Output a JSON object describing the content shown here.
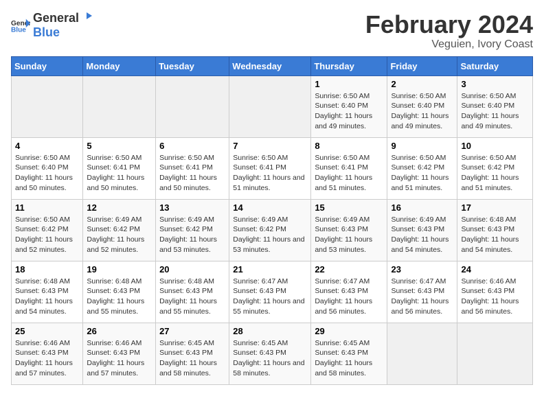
{
  "header": {
    "logo_general": "General",
    "logo_blue": "Blue",
    "title": "February 2024",
    "subtitle": "Veguien, Ivory Coast"
  },
  "weekdays": [
    "Sunday",
    "Monday",
    "Tuesday",
    "Wednesday",
    "Thursday",
    "Friday",
    "Saturday"
  ],
  "weeks": [
    [
      {
        "day": "",
        "empty": true
      },
      {
        "day": "",
        "empty": true
      },
      {
        "day": "",
        "empty": true
      },
      {
        "day": "",
        "empty": true
      },
      {
        "day": "1",
        "sunrise": "6:50 AM",
        "sunset": "6:40 PM",
        "daylight": "11 hours and 49 minutes."
      },
      {
        "day": "2",
        "sunrise": "6:50 AM",
        "sunset": "6:40 PM",
        "daylight": "11 hours and 49 minutes."
      },
      {
        "day": "3",
        "sunrise": "6:50 AM",
        "sunset": "6:40 PM",
        "daylight": "11 hours and 49 minutes."
      }
    ],
    [
      {
        "day": "4",
        "sunrise": "6:50 AM",
        "sunset": "6:40 PM",
        "daylight": "11 hours and 50 minutes."
      },
      {
        "day": "5",
        "sunrise": "6:50 AM",
        "sunset": "6:41 PM",
        "daylight": "11 hours and 50 minutes."
      },
      {
        "day": "6",
        "sunrise": "6:50 AM",
        "sunset": "6:41 PM",
        "daylight": "11 hours and 50 minutes."
      },
      {
        "day": "7",
        "sunrise": "6:50 AM",
        "sunset": "6:41 PM",
        "daylight": "11 hours and 51 minutes."
      },
      {
        "day": "8",
        "sunrise": "6:50 AM",
        "sunset": "6:41 PM",
        "daylight": "11 hours and 51 minutes."
      },
      {
        "day": "9",
        "sunrise": "6:50 AM",
        "sunset": "6:42 PM",
        "daylight": "11 hours and 51 minutes."
      },
      {
        "day": "10",
        "sunrise": "6:50 AM",
        "sunset": "6:42 PM",
        "daylight": "11 hours and 51 minutes."
      }
    ],
    [
      {
        "day": "11",
        "sunrise": "6:50 AM",
        "sunset": "6:42 PM",
        "daylight": "11 hours and 52 minutes."
      },
      {
        "day": "12",
        "sunrise": "6:49 AM",
        "sunset": "6:42 PM",
        "daylight": "11 hours and 52 minutes."
      },
      {
        "day": "13",
        "sunrise": "6:49 AM",
        "sunset": "6:42 PM",
        "daylight": "11 hours and 53 minutes."
      },
      {
        "day": "14",
        "sunrise": "6:49 AM",
        "sunset": "6:42 PM",
        "daylight": "11 hours and 53 minutes."
      },
      {
        "day": "15",
        "sunrise": "6:49 AM",
        "sunset": "6:43 PM",
        "daylight": "11 hours and 53 minutes."
      },
      {
        "day": "16",
        "sunrise": "6:49 AM",
        "sunset": "6:43 PM",
        "daylight": "11 hours and 54 minutes."
      },
      {
        "day": "17",
        "sunrise": "6:48 AM",
        "sunset": "6:43 PM",
        "daylight": "11 hours and 54 minutes."
      }
    ],
    [
      {
        "day": "18",
        "sunrise": "6:48 AM",
        "sunset": "6:43 PM",
        "daylight": "11 hours and 54 minutes."
      },
      {
        "day": "19",
        "sunrise": "6:48 AM",
        "sunset": "6:43 PM",
        "daylight": "11 hours and 55 minutes."
      },
      {
        "day": "20",
        "sunrise": "6:48 AM",
        "sunset": "6:43 PM",
        "daylight": "11 hours and 55 minutes."
      },
      {
        "day": "21",
        "sunrise": "6:47 AM",
        "sunset": "6:43 PM",
        "daylight": "11 hours and 55 minutes."
      },
      {
        "day": "22",
        "sunrise": "6:47 AM",
        "sunset": "6:43 PM",
        "daylight": "11 hours and 56 minutes."
      },
      {
        "day": "23",
        "sunrise": "6:47 AM",
        "sunset": "6:43 PM",
        "daylight": "11 hours and 56 minutes."
      },
      {
        "day": "24",
        "sunrise": "6:46 AM",
        "sunset": "6:43 PM",
        "daylight": "11 hours and 56 minutes."
      }
    ],
    [
      {
        "day": "25",
        "sunrise": "6:46 AM",
        "sunset": "6:43 PM",
        "daylight": "11 hours and 57 minutes."
      },
      {
        "day": "26",
        "sunrise": "6:46 AM",
        "sunset": "6:43 PM",
        "daylight": "11 hours and 57 minutes."
      },
      {
        "day": "27",
        "sunrise": "6:45 AM",
        "sunset": "6:43 PM",
        "daylight": "11 hours and 58 minutes."
      },
      {
        "day": "28",
        "sunrise": "6:45 AM",
        "sunset": "6:43 PM",
        "daylight": "11 hours and 58 minutes."
      },
      {
        "day": "29",
        "sunrise": "6:45 AM",
        "sunset": "6:43 PM",
        "daylight": "11 hours and 58 minutes."
      },
      {
        "day": "",
        "empty": true
      },
      {
        "day": "",
        "empty": true
      }
    ]
  ],
  "labels": {
    "sunrise_prefix": "Sunrise: ",
    "sunset_prefix": "Sunset: ",
    "daylight_prefix": "Daylight: "
  }
}
